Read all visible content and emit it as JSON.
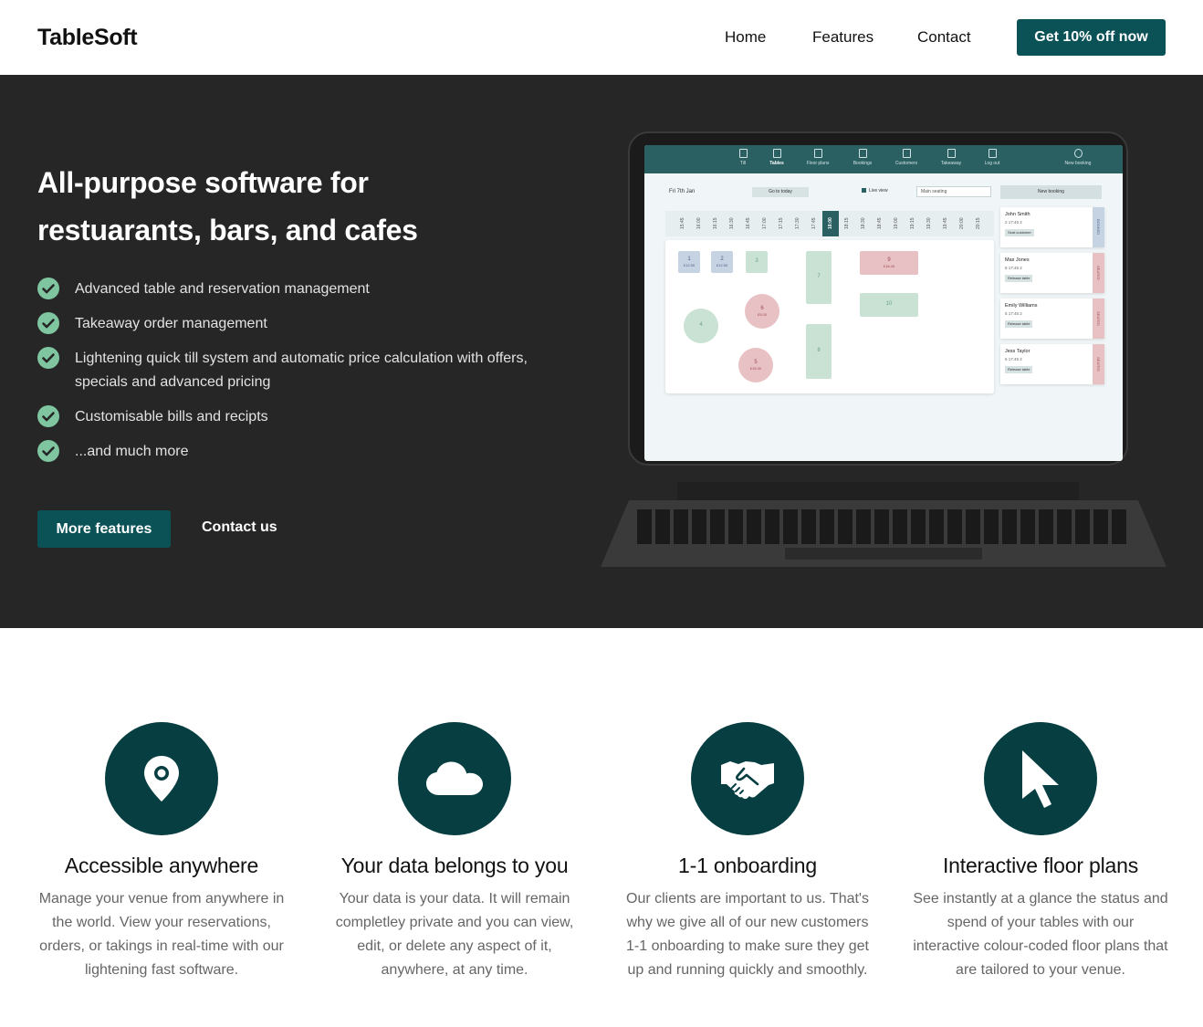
{
  "nav": {
    "logo": "TableSoft",
    "links": [
      "Home",
      "Features",
      "Contact"
    ],
    "cta": "Get 10% off now"
  },
  "hero": {
    "title_line1": "All-purpose software for",
    "title_line2": "restuarants, bars, and cafes",
    "checklist": [
      "Advanced table and reservation management",
      "Takeaway order management",
      "Lightening quick till system and automatic price calculation with offers, specials and advanced pricing",
      "Customisable bills and recipts",
      "...and much more"
    ],
    "primary_button": "More features",
    "secondary_button": "Contact us"
  },
  "app_screen": {
    "tabs": [
      "Till",
      "Tables",
      "Floor plans",
      "Bookings",
      "Customers",
      "Takeaway",
      "Log out",
      "New booking"
    ],
    "date": "Fri 7th Jan",
    "goto_today": "Go to today",
    "live_view": "Live view",
    "seating": "Main seating",
    "new_booking": "New booking",
    "timeline": [
      "15:45",
      "16:00",
      "16:15",
      "16:30",
      "16:45",
      "17:00",
      "17:15",
      "17:30",
      "17:45",
      "18:00",
      "18:15",
      "18:30",
      "18:45",
      "19:00",
      "19:15",
      "19:30",
      "19:45",
      "20:00",
      "20:15"
    ],
    "tables": [
      {
        "num": "1",
        "amount": "£12.50"
      },
      {
        "num": "2",
        "amount": "£12.50"
      },
      {
        "num": "3",
        "amount": ""
      },
      {
        "num": "4",
        "amount": ""
      },
      {
        "num": "5",
        "amount": "£16.00"
      },
      {
        "num": "6",
        "amount": "£5.00"
      },
      {
        "num": "7",
        "amount": ""
      },
      {
        "num": "8",
        "amount": ""
      },
      {
        "num": "9",
        "amount": "£18.45"
      },
      {
        "num": "10",
        "amount": ""
      }
    ],
    "bookings": [
      {
        "name": "John Smith",
        "meta": "2   17:45   2",
        "button": "Seat customer",
        "status": "BOOKED"
      },
      {
        "name": "Max Jones",
        "meta": "8   17:45   2",
        "button": "Release table",
        "status": "SEATED"
      },
      {
        "name": "Emily Williams",
        "meta": "5   17:45   2",
        "button": "Release table",
        "status": "SEATED"
      },
      {
        "name": "Jess Taylor",
        "meta": "6   17:45   2",
        "button": "Release table",
        "status": "SEATED"
      }
    ]
  },
  "features": [
    {
      "icon": "location-pin-icon",
      "title": "Accessible anywhere",
      "desc": "Manage your venue from anywhere in the world. View your reservations, orders, or takings in real-time with our lightening fast software."
    },
    {
      "icon": "cloud-icon",
      "title": "Your data belongs to you",
      "desc": "Your data is your data. It will remain completley private and you can view, edit, or delete any aspect of it, anywhere, at any time."
    },
    {
      "icon": "handshake-icon",
      "title": "1-1 onboarding",
      "desc": "Our clients are important to us. That's why we give all of our new customers 1-1 onboarding to make sure they get up and running quickly and smoothly."
    },
    {
      "icon": "pointer-icon",
      "title": "Interactive floor plans",
      "desc": "See instantly at a glance the status and spend of your tables with our interactive colour-coded floor plans that are tailored to your venue."
    }
  ],
  "colors": {
    "brand": "#0b5257",
    "icon_circle": "#073e42",
    "hero_bg": "#262626",
    "check_green": "#7fc6a0"
  }
}
